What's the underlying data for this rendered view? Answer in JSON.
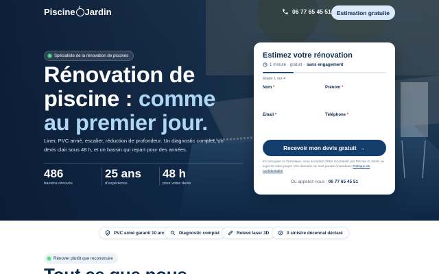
{
  "brand": {
    "name_left": "Piscine",
    "name_right": "Jardin"
  },
  "nav": {
    "phone": "06 77 65 45 51",
    "cta_label": "Estimation gratuite"
  },
  "hero": {
    "badge": "Spécialiste de la rénovation de piscines",
    "title_line1": "Rénovation de",
    "title_line2_plain": "piscine : ",
    "title_line2_accent": "comme",
    "title_line3_accent": "au premier jour.",
    "lead": "Liner, PVC armé, escalier, réduction de profondeur. Un diagnostic complet, un devis clair sous 48 h, et un bassin qui repart pour des années.",
    "stats": [
      {
        "value": "486",
        "label": "bassins rénovés"
      },
      {
        "value": "25 ans",
        "label": "d'expérience"
      },
      {
        "value": "48 h",
        "label": "pour votre devis"
      }
    ]
  },
  "form": {
    "title": "Estimez votre rénovation",
    "sub_plain": "1 minute · gratuit · ",
    "sub_bold": "sans engagement",
    "progress_fraction": 0.25,
    "step": "Étape 1 sur 4",
    "fields": [
      {
        "label": "Nom"
      },
      {
        "label": "Prénom"
      },
      {
        "label": "Email"
      },
      {
        "label": "Téléphone"
      }
    ],
    "required_mark": "*",
    "submit_label": "Recevoir mon devis gratuit",
    "submit_arrow": "→",
    "legal_text": "En envoyant ce formulaire, vous acceptez d'être recontacté par Piscine O Jardin au sujet de votre projet. Vos données ne sont jamais revendues.",
    "legal_link": "Politique de confidentialité",
    "call_prefix": "Ou appelez-nous : ",
    "call_phone": "06 77 65 45 51"
  },
  "trust": [
    {
      "label": "PVC armé garanti 10 ans",
      "icon": "shield-icon"
    },
    {
      "label": "Diagnostic complet",
      "icon": "search-icon"
    },
    {
      "label": "Relevé laser 3D",
      "icon": "ruler-icon"
    },
    {
      "label": "0 sinistre décennal déclaré",
      "icon": "check-circle-icon"
    }
  ],
  "section": {
    "badge": "Rénover plutôt que reconstruire",
    "title": "Tout ce que nous"
  },
  "colors": {
    "navy": "#0d2a4d",
    "accent_light": "#aed6f5",
    "button": "#133d6b",
    "badge_dot": "#4ee08a"
  }
}
